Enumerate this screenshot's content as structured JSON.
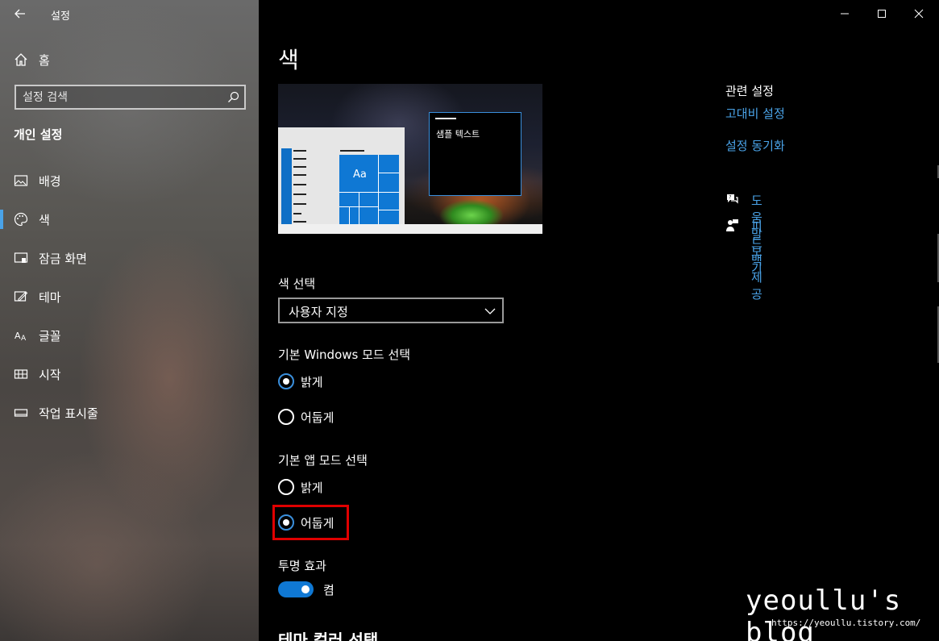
{
  "app": {
    "title": "설정"
  },
  "sidebar": {
    "home_label": "홈",
    "search_placeholder": "설정 검색",
    "section_title": "개인 설정",
    "items": [
      {
        "label": "배경",
        "icon": "image-icon",
        "active": false
      },
      {
        "label": "색",
        "icon": "palette-icon",
        "active": true
      },
      {
        "label": "잠금 화면",
        "icon": "lock-screen-icon",
        "active": false
      },
      {
        "label": "테마",
        "icon": "theme-icon",
        "active": false
      },
      {
        "label": "글꼴",
        "icon": "font-icon",
        "active": false
      },
      {
        "label": "시작",
        "icon": "start-icon",
        "active": false
      },
      {
        "label": "작업 표시줄",
        "icon": "taskbar-icon",
        "active": false
      }
    ]
  },
  "main": {
    "title": "색",
    "preview": {
      "sample_text": "샘플 텍스트",
      "tile_text": "Aa"
    },
    "color_choice": {
      "label": "색 선택",
      "selected": "사용자 지정"
    },
    "windows_mode": {
      "label": "기본 Windows 모드 선택",
      "options": [
        "밝게",
        "어둡게"
      ],
      "selected_index": 0
    },
    "app_mode": {
      "label": "기본 앱 모드 선택",
      "options": [
        "밝게",
        "어둡게"
      ],
      "selected_index": 1
    },
    "transparency": {
      "label": "투명 효과",
      "state_label": "켬",
      "on": true
    },
    "bottom_heading": "테마 컬러 선택"
  },
  "related": {
    "title": "관련 설정",
    "links": [
      "고대비 설정",
      "설정 동기화"
    ],
    "help": [
      {
        "label": "도움말 보기",
        "icon": "help-chat-icon"
      },
      {
        "label": "피드백 제공",
        "icon": "feedback-icon"
      }
    ]
  },
  "watermark": {
    "text": "yeoullu's blog",
    "url": "https://yeoullu.tistory.com/"
  },
  "colors": {
    "accent": "#0f78d4",
    "link": "#4aa3e8",
    "highlight": "#e00000"
  }
}
